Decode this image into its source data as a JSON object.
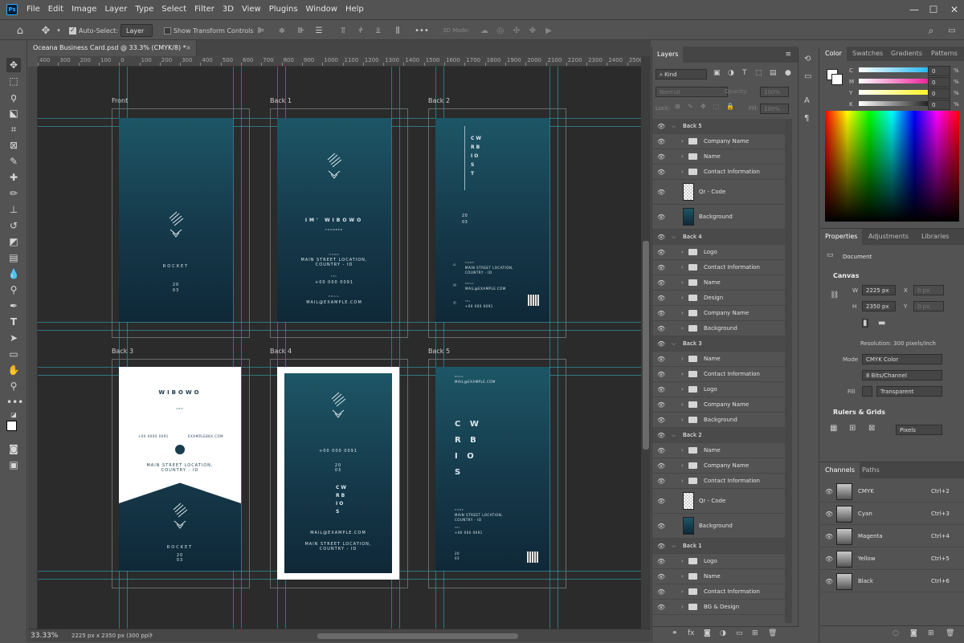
{
  "app": {
    "logo_text": "Ps"
  },
  "menubar": {
    "items": [
      "File",
      "Edit",
      "Image",
      "Layer",
      "Type",
      "Select",
      "Filter",
      "3D",
      "View",
      "Plugins",
      "Window",
      "Help"
    ]
  },
  "optionsbar": {
    "auto_select_label": "Auto-Select:",
    "auto_select_value": "Layer",
    "show_transform_label": "Show Transform Controls",
    "mode3d_label": "3D Mode:"
  },
  "document": {
    "tab_title": "Oceana Business Card.psd @ 33.3% (CMYK/8) *",
    "zoom": "33.33%",
    "doc_info": "2225 px x 2350 px (300 ppi)"
  },
  "ruler": {
    "h_ticks": [
      "400",
      "300",
      "200",
      "100",
      "0",
      "100",
      "200",
      "300",
      "400",
      "500",
      "600",
      "700",
      "800",
      "900",
      "1000",
      "1100",
      "1200",
      "1300",
      "1400",
      "1500",
      "1600",
      "1700",
      "1800",
      "1900",
      "2000",
      "2100",
      "2200",
      "2300",
      "2400",
      "2500"
    ]
  },
  "artboards": [
    {
      "label": "Front",
      "name_text": "ROCKET",
      "year": "20\n03"
    },
    {
      "label": "Back 1",
      "name_text": "IM' WIBOWO",
      "role": "FOUNDER",
      "home_label": "HOME",
      "address": "MAIN STREET LOCATION,\nCOUNTRY - ID",
      "tel_label": "TEL",
      "phone": "+00 000 0091",
      "email_label": "EMAIL",
      "email": "MAIL@EXAMPLE.COM"
    },
    {
      "label": "Back 2",
      "vertical": "CW\nRB\nIO\nS\nT",
      "year": "20\n03",
      "home_label": "HOME",
      "address": "MAIN STREET LOCATION,\nCOUNTRY - ID",
      "email_label": "EMAIL",
      "email": "MAIL@EXAMPLE.COM",
      "tel_label": "TEL",
      "phone": "+00 000 0091"
    },
    {
      "label": "Back 3",
      "name_text": "WIBOWO",
      "role": "CEO",
      "phone": "+00 0000 0091",
      "site": "EXAMPLE88X.COM",
      "address": "MAIN STREET LOCATION,\nCOUNTRY - ID",
      "brand": "ROCKET",
      "year": "20\n03"
    },
    {
      "label": "Back 4",
      "phone": "+00 000 0091",
      "year": "20\n03",
      "vertical": "CW\nRB\nIO\nS",
      "email": "MAIL@EXAMPLE.COM",
      "address": "MAIN STREET LOCATION,\nCOUNTRY - ID"
    },
    {
      "label": "Back 5",
      "email_label": "EMAIL",
      "email": "MAIL@EXAMPLE.COM",
      "big": "C W\nR B\nI O\nS",
      "home_label": "HOME",
      "address": "MAIN STREET LOCATION,\nCOUNTRY - ID",
      "tel_label": "TEL",
      "phone": "+00 000 0091",
      "year": "20\n03"
    }
  ],
  "layers_panel": {
    "tab": "Layers",
    "filter_kind": "Kind",
    "blend_mode": "Normal",
    "opacity_label": "Opacity:",
    "opacity_value": "100%",
    "lock_label": "Lock:",
    "fill_label": "Fill:",
    "fill_value": "100%",
    "rows": [
      {
        "type": "group",
        "name": "Back 5"
      },
      {
        "type": "folder",
        "name": "Company Name"
      },
      {
        "type": "folder",
        "name": "Name"
      },
      {
        "type": "folder",
        "name": "Contact Information"
      },
      {
        "type": "layer",
        "name": "Qr - Code",
        "thumb": "qr"
      },
      {
        "type": "layer",
        "name": "Background",
        "thumb": "bg"
      },
      {
        "type": "group",
        "name": "Back 4"
      },
      {
        "type": "folder",
        "name": "Logo"
      },
      {
        "type": "folder",
        "name": "Contact Information"
      },
      {
        "type": "folder",
        "name": "Name"
      },
      {
        "type": "folder",
        "name": "Design"
      },
      {
        "type": "folder",
        "name": "Company Name"
      },
      {
        "type": "folder",
        "name": "Background"
      },
      {
        "type": "group",
        "name": "Back 3"
      },
      {
        "type": "folder",
        "name": "Name"
      },
      {
        "type": "folder",
        "name": "Contact Information"
      },
      {
        "type": "folder",
        "name": "Logo"
      },
      {
        "type": "folder",
        "name": "Company Name"
      },
      {
        "type": "folder",
        "name": "Background"
      },
      {
        "type": "group",
        "name": "Back 2"
      },
      {
        "type": "folder",
        "name": "Name"
      },
      {
        "type": "folder",
        "name": "Company Name"
      },
      {
        "type": "folder",
        "name": "Contact Information"
      },
      {
        "type": "layer",
        "name": "Qr - Code",
        "thumb": "qr"
      },
      {
        "type": "layer",
        "name": "Background",
        "thumb": "bg"
      },
      {
        "type": "group",
        "name": "Back 1"
      },
      {
        "type": "folder",
        "name": "Logo"
      },
      {
        "type": "folder",
        "name": "Name"
      },
      {
        "type": "folder",
        "name": "Contact Information"
      },
      {
        "type": "folder",
        "name": "BG & Design"
      }
    ]
  },
  "color_panel": {
    "tabs": [
      "Color",
      "Swatches",
      "Gradients",
      "Patterns"
    ],
    "channels": [
      {
        "label": "C",
        "value": "0",
        "unit": "%"
      },
      {
        "label": "M",
        "value": "0",
        "unit": "%"
      },
      {
        "label": "Y",
        "value": "0",
        "unit": "%"
      },
      {
        "label": "K",
        "value": "0",
        "unit": "%"
      }
    ]
  },
  "properties_panel": {
    "tabs": [
      "Properties",
      "Adjustments",
      "Libraries"
    ],
    "doc_label": "Document",
    "canvas_title": "Canvas",
    "w_label": "W",
    "w_value": "2225 px",
    "h_label": "H",
    "h_value": "2350 px",
    "x_label": "X",
    "x_value": "0 px",
    "y_label": "Y",
    "y_value": "0 px",
    "resolution": "Resolution: 300 pixels/inch",
    "mode_label": "Mode",
    "mode_value": "CMYK Color",
    "depth_value": "8 Bits/Channel",
    "fill_label": "Fill",
    "fill_value": "Transparent",
    "rulers_title": "Rulers & Grids",
    "units_value": "Pixels"
  },
  "channels_panel": {
    "tabs": [
      "Channels",
      "Paths"
    ],
    "rows": [
      {
        "name": "CMYK",
        "key": "Ctrl+2"
      },
      {
        "name": "Cyan",
        "key": "Ctrl+3"
      },
      {
        "name": "Magenta",
        "key": "Ctrl+4"
      },
      {
        "name": "Yellow",
        "key": "Ctrl+5"
      },
      {
        "name": "Black",
        "key": "Ctrl+6"
      }
    ]
  },
  "colors": {
    "accent": "#31a8ff",
    "guide": "#2fb7c7",
    "card_top": "#1d5666",
    "card_bottom": "#0f2838"
  }
}
